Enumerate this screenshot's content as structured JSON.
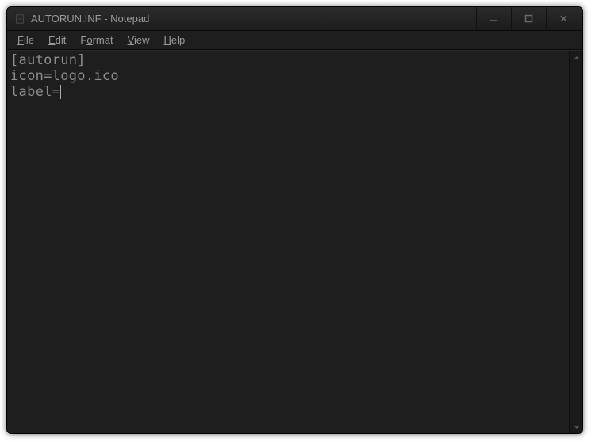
{
  "window": {
    "title": "AUTORUN.INF - Notepad"
  },
  "menubar": {
    "items": [
      {
        "label": "File",
        "mnemonic": "F"
      },
      {
        "label": "Edit",
        "mnemonic": "E"
      },
      {
        "label": "Format",
        "mnemonic": "o"
      },
      {
        "label": "View",
        "mnemonic": "V"
      },
      {
        "label": "Help",
        "mnemonic": "H"
      }
    ]
  },
  "editor": {
    "content": "[autorun]\nicon=logo.ico\nlabel="
  }
}
